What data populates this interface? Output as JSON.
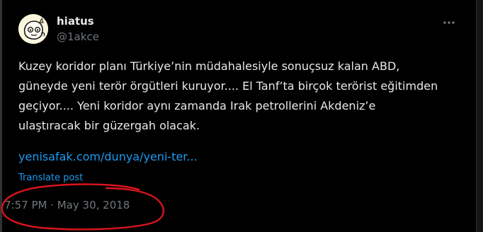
{
  "tweet": {
    "author_name": "hiatus",
    "author_handle": "@1akce",
    "more_icon": "more-horizontal-icon",
    "text_lines": [
      "Kuzey koridor planı Türkiye’nin müdahalesiyle sonuçsuz kalan ABD,",
      "güneyde yeni terör örgütleri kuruyor.... El Tanf’ta birçok terörist eğitimden",
      "geçiyor.... Yeni koridor aynı zamanda Irak petrollerini Akdeniz’e",
      "ulaştıracak bir güzergah olacak."
    ],
    "link_text": "yenisafak.com/dunya/yeni-ter...",
    "translate_label": "Translate post",
    "timestamp": "7:57 PM · May 30, 2018"
  },
  "annotation": {
    "type": "hand-drawn circle",
    "color": "#d8141c"
  },
  "colors": {
    "background": "#000000",
    "primary_text": "#e7e9ea",
    "secondary_text": "#71767b",
    "link": "#1d9bf0"
  }
}
